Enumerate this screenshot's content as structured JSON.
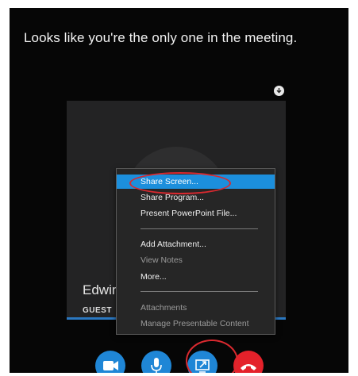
{
  "meeting": {
    "message": "Looks like you're the only one in the meeting."
  },
  "participant": {
    "name": "Edwir",
    "role": "GUEST"
  },
  "menu": {
    "items": [
      {
        "label": "Share Screen...",
        "state": "selected"
      },
      {
        "label": "Share Program...",
        "state": "normal"
      },
      {
        "label": "Present PowerPoint File...",
        "state": "normal"
      },
      {
        "label": "Add Attachment...",
        "state": "normal"
      },
      {
        "label": "View Notes",
        "state": "disabled"
      },
      {
        "label": "More...",
        "state": "normal"
      },
      {
        "label": "Attachments",
        "state": "disabled"
      },
      {
        "label": "Manage Presentable Content",
        "state": "disabled"
      }
    ]
  },
  "controls": {
    "buttons": [
      {
        "name": "video-button",
        "icon": "video-camera-icon",
        "color": "#1f86d6"
      },
      {
        "name": "microphone-button",
        "icon": "microphone-icon",
        "color": "#1f86d6"
      },
      {
        "name": "present-button",
        "icon": "share-screen-icon",
        "color": "#1f86d6"
      },
      {
        "name": "hang-up-button",
        "icon": "phone-hang-up-icon",
        "color": "#e4212a"
      }
    ]
  },
  "colors": {
    "accent": "#1c8fdc",
    "annotation": "#d9292f",
    "hangup": "#e4212a"
  }
}
